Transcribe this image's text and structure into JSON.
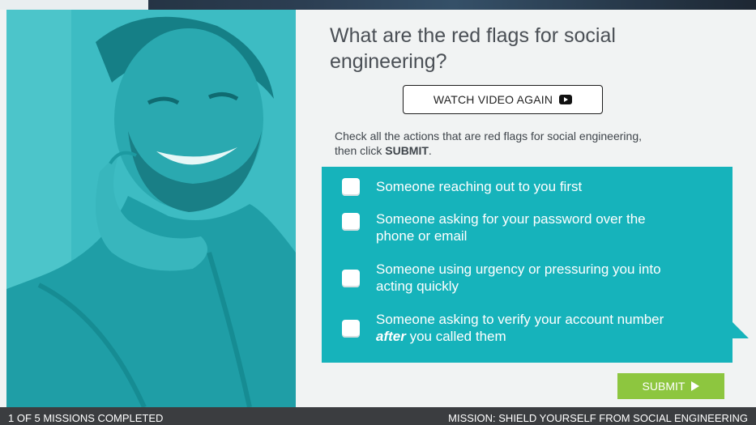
{
  "question": {
    "line1": "What are the red flags for social",
    "line2": "engineering?"
  },
  "video_button": {
    "label": "WATCH VIDEO AGAIN",
    "icon": "youtube-play-icon"
  },
  "instructions": {
    "prefix": "Check all the actions that are red flags for social engineering,",
    "line2_prefix": "then click ",
    "submit_word": "SUBMIT",
    "line2_suffix": "."
  },
  "options": [
    {
      "line1": "Someone reaching out to you first",
      "line2": ""
    },
    {
      "line1": "Someone asking for your password over the",
      "line2": "phone or email"
    },
    {
      "line1": "Someone using urgency or pressuring you into",
      "line2": "acting quickly"
    },
    {
      "line1": "Someone asking to verify your account number",
      "line2_emph": "after",
      "line2": " you called them"
    }
  ],
  "submit": {
    "label": "SUBMIT",
    "icon": "play-icon"
  },
  "footer": {
    "progress": "1 OF 5 MISSIONS COMPLETED",
    "mission": "MISSION: SHIELD YOURSELF FROM SOCIAL ENGINEERING"
  },
  "colors": {
    "teal": "#16b3bb",
    "submit_green": "#8dc63f",
    "footer": "#3b3d40"
  }
}
